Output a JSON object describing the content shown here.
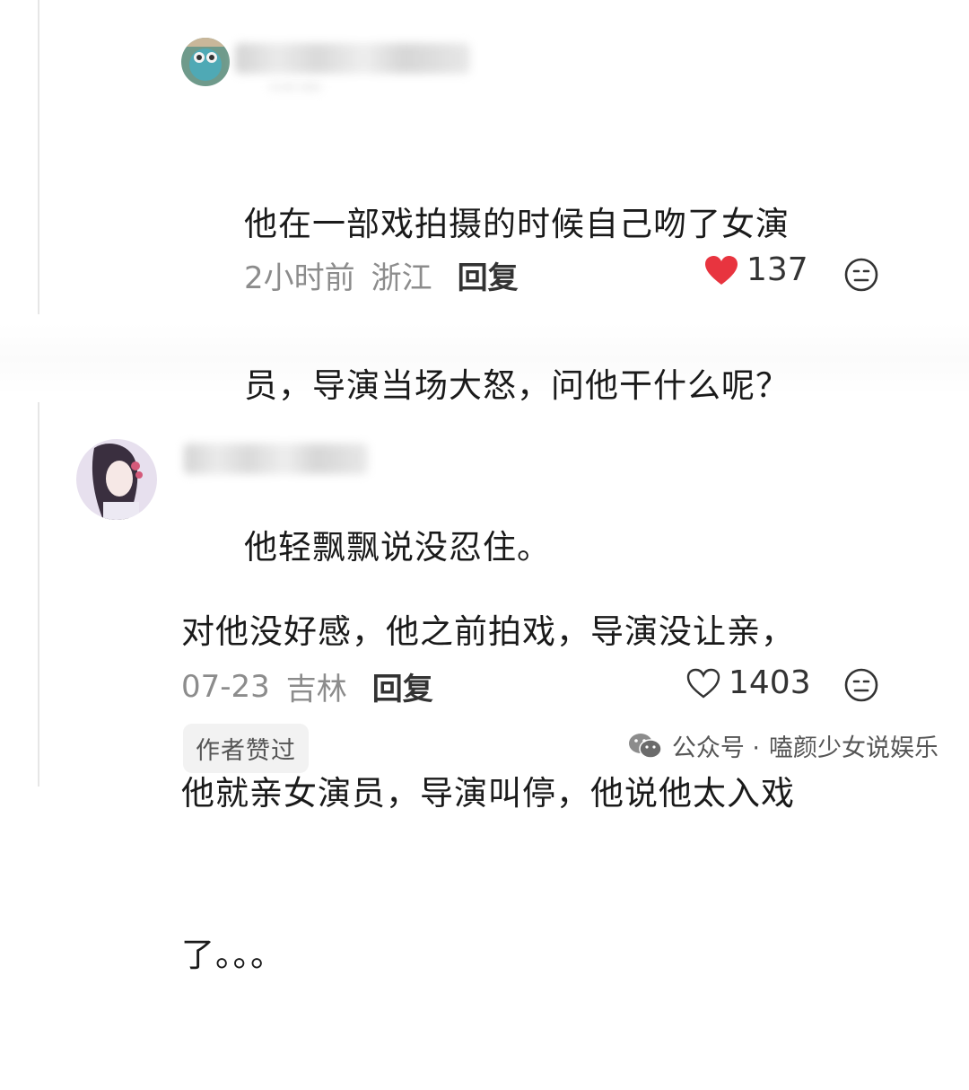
{
  "comments": [
    {
      "text_lines": [
        "他在一部戏拍摄的时候自己吻了女演",
        "员，导演当场大怒，问他干什么呢？",
        "他轻飘飘说没忍住。"
      ],
      "time": "2小时前",
      "location": "浙江",
      "reply_label": "回复",
      "like_count": "137",
      "liked": true
    },
    {
      "text_lines": [
        "对他没好感，他之前拍戏，导演没让亲，",
        "他就亲女演员，导演叫停，他说他太入戏",
        "了。。。"
      ],
      "time": "07-23",
      "location": "吉林",
      "reply_label": "回复",
      "like_count": "1403",
      "liked": false,
      "badge": "作者赞过"
    }
  ],
  "watermark": {
    "prefix": "公众号 ·",
    "name": "嗑颜少女说娱乐"
  },
  "colors": {
    "heart_red": "#e8343f",
    "text_primary": "#1a1a1a",
    "text_secondary": "#8c8c8c"
  }
}
